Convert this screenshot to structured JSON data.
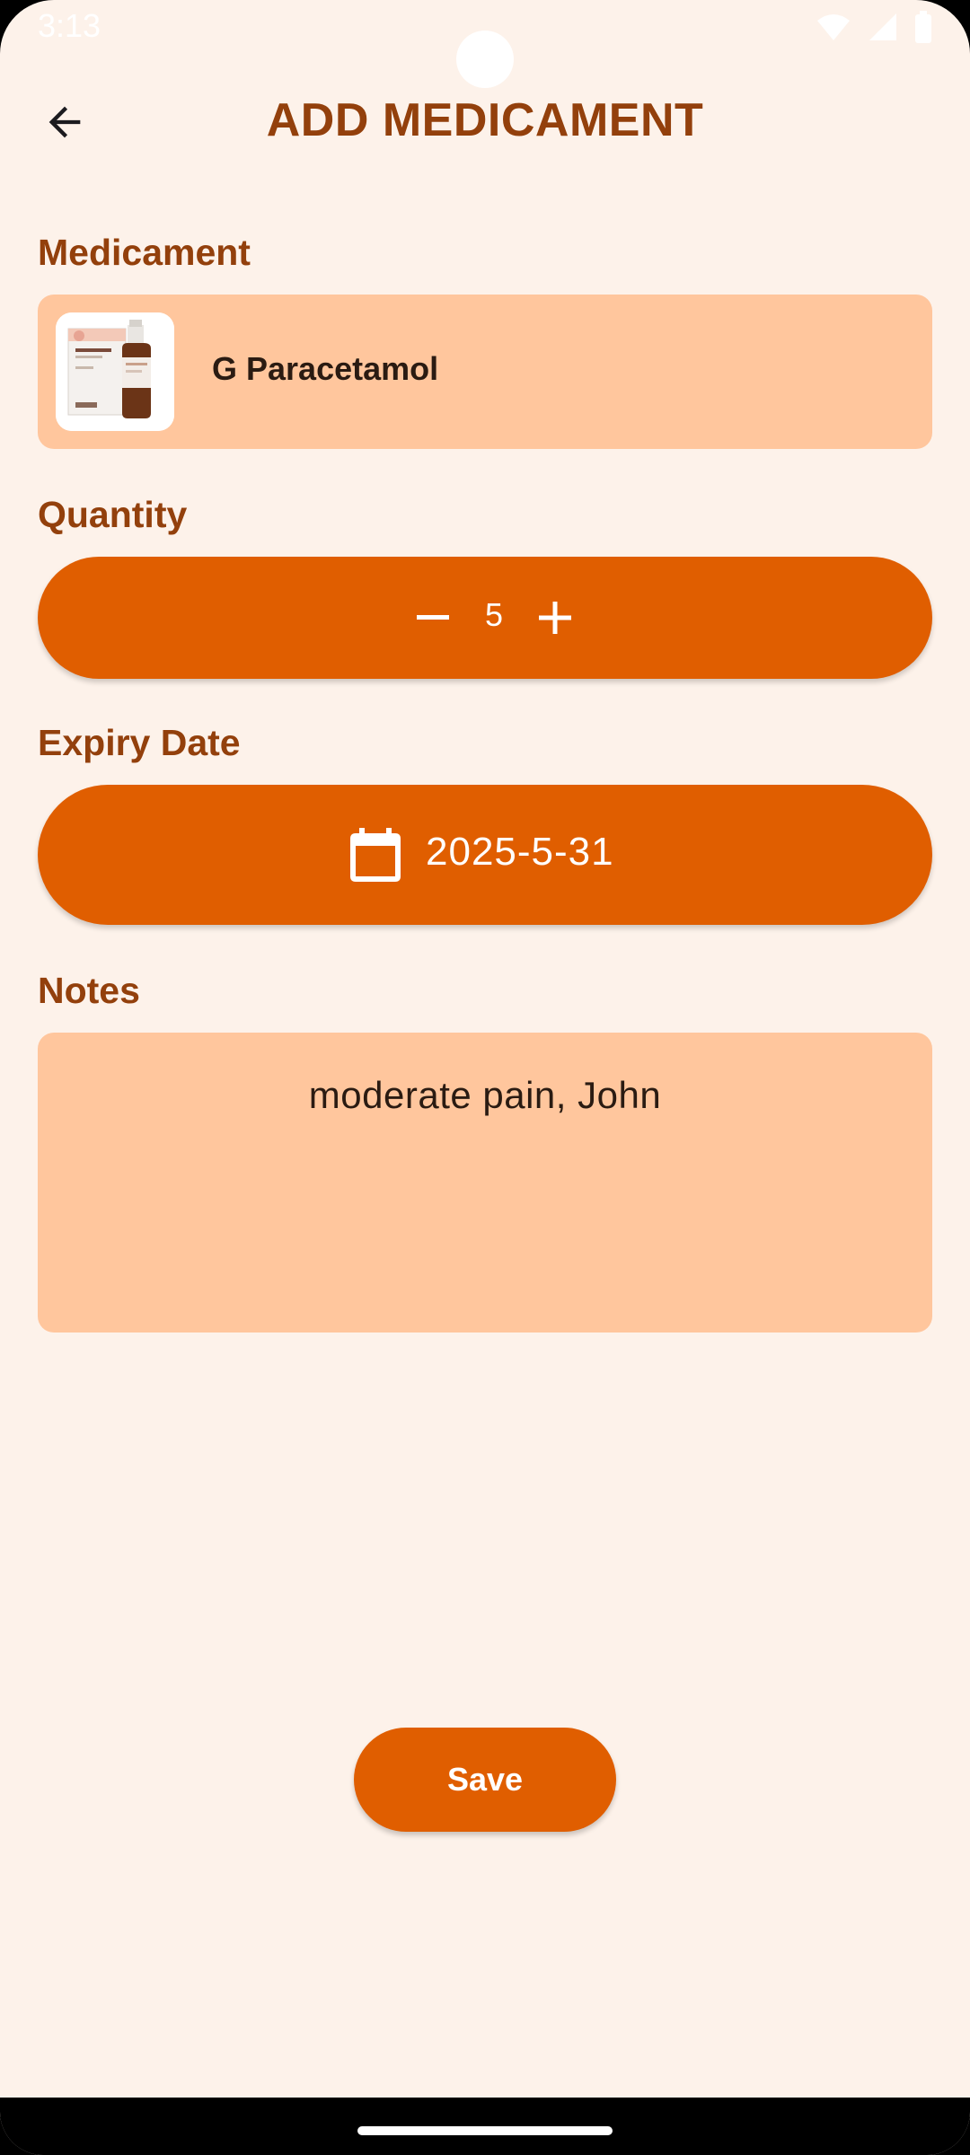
{
  "status_bar": {
    "time": "3:13",
    "icons": [
      "wifi-icon",
      "signal-icon",
      "battery-icon"
    ]
  },
  "header": {
    "title": "ADD MEDICAMENT",
    "back_icon": "arrow-left-icon"
  },
  "medicament": {
    "label": "Medicament",
    "name": "G Paracetamol",
    "image": "medicine-bottle-box"
  },
  "quantity": {
    "label": "Quantity",
    "value": "5",
    "decrement_icon": "minus-icon",
    "increment_icon": "plus-icon"
  },
  "expiry": {
    "label": "Expiry Date",
    "value": "2025-5-31",
    "icon": "calendar-icon"
  },
  "notes": {
    "label": "Notes",
    "value": "moderate pain, John"
  },
  "actions": {
    "save_label": "Save"
  },
  "colors": {
    "background": "#fdf2ea",
    "accent": "#e05e00",
    "card": "#ffc69d",
    "label": "#93400c"
  }
}
